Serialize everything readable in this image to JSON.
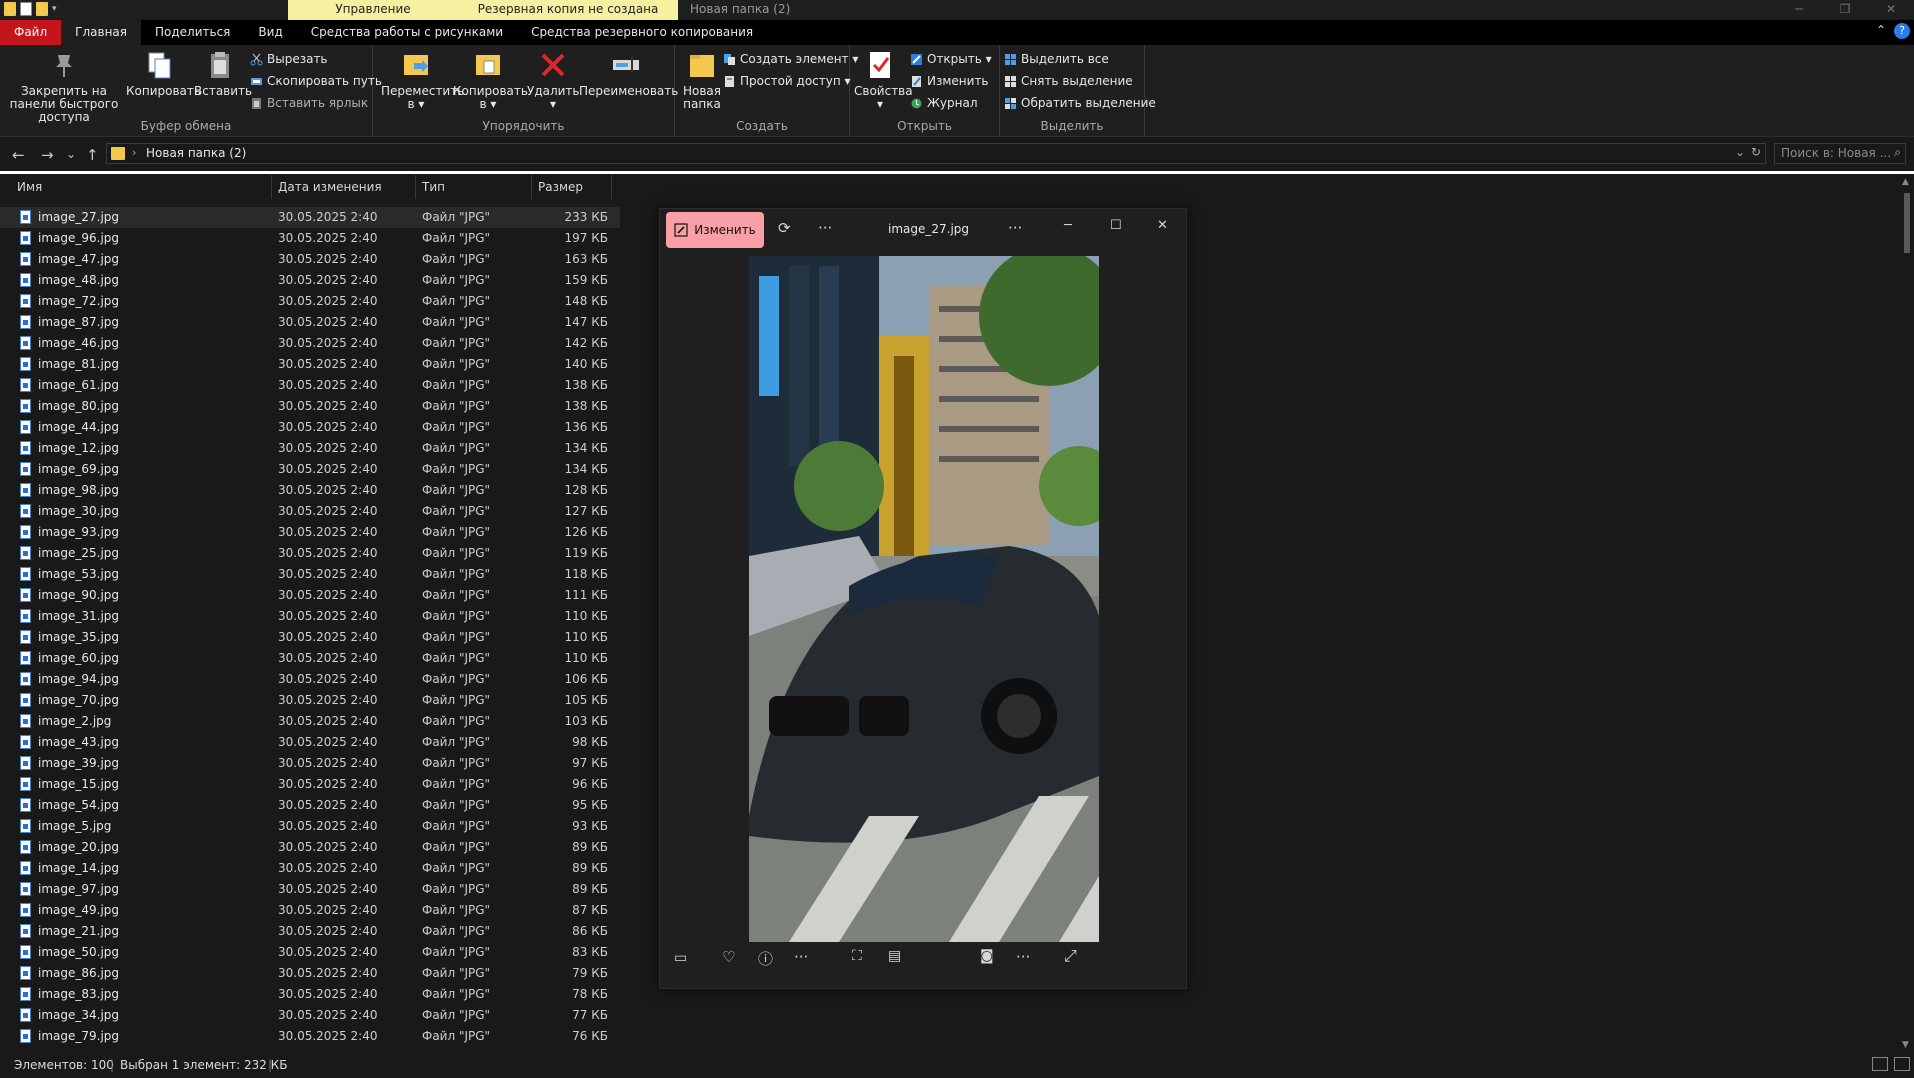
{
  "titlebar": {
    "context_tab_manage": "Управление",
    "context_tab_backup": "Резервная копия не создана",
    "window_title": "Новая папка (2)",
    "qa_arrow": "▾",
    "min": "─",
    "max": "❐",
    "close": "✕"
  },
  "tabs": {
    "file": "Файл",
    "home": "Главная",
    "share": "Поделиться",
    "view": "Вид",
    "picture_tools": "Средства работы с рисунками",
    "backup_tools": "Средства резервного копирования",
    "collapse": "⌃",
    "help": "?"
  },
  "ribbon": {
    "clipboard": {
      "pin": "Закрепить на панели быстрого доступа",
      "copy": "Копировать",
      "paste": "Вставить",
      "cut": "Вырезать",
      "copy_path": "Скопировать путь",
      "paste_shortcut": "Вставить ярлык",
      "label": "Буфер обмена"
    },
    "organize": {
      "move_to": "Переместить в ▾",
      "copy_to": "Копировать в ▾",
      "delete": "Удалить ▾",
      "rename": "Переименовать",
      "label": "Упорядочить"
    },
    "create": {
      "new_folder": "Новая папка",
      "new_item": "Создать элемент ▾",
      "easy_access": "Простой доступ ▾",
      "label": "Создать"
    },
    "open": {
      "properties": "Свойства ▾",
      "open": "Открыть ▾",
      "edit": "Изменить",
      "history": "Журнал",
      "label": "Открыть"
    },
    "select": {
      "select_all": "Выделить все",
      "select_none": "Снять выделение",
      "invert": "Обратить выделение",
      "label": "Выделить"
    }
  },
  "address": {
    "back": "←",
    "forward": "→",
    "recent": "⌄",
    "up": "↑",
    "sep": "›",
    "path": "Новая папка (2)",
    "dropdown": "⌄",
    "refresh": "↻",
    "search_placeholder": "Поиск в: Новая ...",
    "search_icon": "⌕"
  },
  "columns": {
    "name": "Имя",
    "date": "Дата изменения",
    "type": "Тип",
    "size": "Размер"
  },
  "files": [
    {
      "name": "image_27.jpg",
      "date": "30.05.2025 2:40",
      "type": "Файл \"JPG\"",
      "size": "233 КБ"
    },
    {
      "name": "image_96.jpg",
      "date": "30.05.2025 2:40",
      "type": "Файл \"JPG\"",
      "size": "197 КБ"
    },
    {
      "name": "image_47.jpg",
      "date": "30.05.2025 2:40",
      "type": "Файл \"JPG\"",
      "size": "163 КБ"
    },
    {
      "name": "image_48.jpg",
      "date": "30.05.2025 2:40",
      "type": "Файл \"JPG\"",
      "size": "159 КБ"
    },
    {
      "name": "image_72.jpg",
      "date": "30.05.2025 2:40",
      "type": "Файл \"JPG\"",
      "size": "148 КБ"
    },
    {
      "name": "image_87.jpg",
      "date": "30.05.2025 2:40",
      "type": "Файл \"JPG\"",
      "size": "147 КБ"
    },
    {
      "name": "image_46.jpg",
      "date": "30.05.2025 2:40",
      "type": "Файл \"JPG\"",
      "size": "142 КБ"
    },
    {
      "name": "image_81.jpg",
      "date": "30.05.2025 2:40",
      "type": "Файл \"JPG\"",
      "size": "140 КБ"
    },
    {
      "name": "image_61.jpg",
      "date": "30.05.2025 2:40",
      "type": "Файл \"JPG\"",
      "size": "138 КБ"
    },
    {
      "name": "image_80.jpg",
      "date": "30.05.2025 2:40",
      "type": "Файл \"JPG\"",
      "size": "138 КБ"
    },
    {
      "name": "image_44.jpg",
      "date": "30.05.2025 2:40",
      "type": "Файл \"JPG\"",
      "size": "136 КБ"
    },
    {
      "name": "image_12.jpg",
      "date": "30.05.2025 2:40",
      "type": "Файл \"JPG\"",
      "size": "134 КБ"
    },
    {
      "name": "image_69.jpg",
      "date": "30.05.2025 2:40",
      "type": "Файл \"JPG\"",
      "size": "134 КБ"
    },
    {
      "name": "image_98.jpg",
      "date": "30.05.2025 2:40",
      "type": "Файл \"JPG\"",
      "size": "128 КБ"
    },
    {
      "name": "image_30.jpg",
      "date": "30.05.2025 2:40",
      "type": "Файл \"JPG\"",
      "size": "127 КБ"
    },
    {
      "name": "image_93.jpg",
      "date": "30.05.2025 2:40",
      "type": "Файл \"JPG\"",
      "size": "126 КБ"
    },
    {
      "name": "image_25.jpg",
      "date": "30.05.2025 2:40",
      "type": "Файл \"JPG\"",
      "size": "119 КБ"
    },
    {
      "name": "image_53.jpg",
      "date": "30.05.2025 2:40",
      "type": "Файл \"JPG\"",
      "size": "118 КБ"
    },
    {
      "name": "image_90.jpg",
      "date": "30.05.2025 2:40",
      "type": "Файл \"JPG\"",
      "size": "111 КБ"
    },
    {
      "name": "image_31.jpg",
      "date": "30.05.2025 2:40",
      "type": "Файл \"JPG\"",
      "size": "110 КБ"
    },
    {
      "name": "image_35.jpg",
      "date": "30.05.2025 2:40",
      "type": "Файл \"JPG\"",
      "size": "110 КБ"
    },
    {
      "name": "image_60.jpg",
      "date": "30.05.2025 2:40",
      "type": "Файл \"JPG\"",
      "size": "110 КБ"
    },
    {
      "name": "image_94.jpg",
      "date": "30.05.2025 2:40",
      "type": "Файл \"JPG\"",
      "size": "106 КБ"
    },
    {
      "name": "image_70.jpg",
      "date": "30.05.2025 2:40",
      "type": "Файл \"JPG\"",
      "size": "105 КБ"
    },
    {
      "name": "image_2.jpg",
      "date": "30.05.2025 2:40",
      "type": "Файл \"JPG\"",
      "size": "103 КБ"
    },
    {
      "name": "image_43.jpg",
      "date": "30.05.2025 2:40",
      "type": "Файл \"JPG\"",
      "size": "98 КБ"
    },
    {
      "name": "image_39.jpg",
      "date": "30.05.2025 2:40",
      "type": "Файл \"JPG\"",
      "size": "97 КБ"
    },
    {
      "name": "image_15.jpg",
      "date": "30.05.2025 2:40",
      "type": "Файл \"JPG\"",
      "size": "96 КБ"
    },
    {
      "name": "image_54.jpg",
      "date": "30.05.2025 2:40",
      "type": "Файл \"JPG\"",
      "size": "95 КБ"
    },
    {
      "name": "image_5.jpg",
      "date": "30.05.2025 2:40",
      "type": "Файл \"JPG\"",
      "size": "93 КБ"
    },
    {
      "name": "image_20.jpg",
      "date": "30.05.2025 2:40",
      "type": "Файл \"JPG\"",
      "size": "89 КБ"
    },
    {
      "name": "image_14.jpg",
      "date": "30.05.2025 2:40",
      "type": "Файл \"JPG\"",
      "size": "89 КБ"
    },
    {
      "name": "image_97.jpg",
      "date": "30.05.2025 2:40",
      "type": "Файл \"JPG\"",
      "size": "89 КБ"
    },
    {
      "name": "image_49.jpg",
      "date": "30.05.2025 2:40",
      "type": "Файл \"JPG\"",
      "size": "87 КБ"
    },
    {
      "name": "image_21.jpg",
      "date": "30.05.2025 2:40",
      "type": "Файл \"JPG\"",
      "size": "86 КБ"
    },
    {
      "name": "image_50.jpg",
      "date": "30.05.2025 2:40",
      "type": "Файл \"JPG\"",
      "size": "83 КБ"
    },
    {
      "name": "image_86.jpg",
      "date": "30.05.2025 2:40",
      "type": "Файл \"JPG\"",
      "size": "79 КБ"
    },
    {
      "name": "image_83.jpg",
      "date": "30.05.2025 2:40",
      "type": "Файл \"JPG\"",
      "size": "78 КБ"
    },
    {
      "name": "image_34.jpg",
      "date": "30.05.2025 2:40",
      "type": "Файл \"JPG\"",
      "size": "77 КБ"
    },
    {
      "name": "image_79.jpg",
      "date": "30.05.2025 2:40",
      "type": "Файл \"JPG\"",
      "size": "76 КБ"
    }
  ],
  "status": {
    "count": "Элементов: 100",
    "selected": "Выбран 1 элемент: 232 КБ"
  },
  "viewer": {
    "edit": "Изменить",
    "title": "image_27.jpg",
    "more": "···",
    "rotate": "⟳",
    "min": "─",
    "max": "☐",
    "close": "✕",
    "favorite": "♡",
    "info": "ⓘ",
    "expand": "⤢"
  },
  "colors": {
    "file_tab": "#c4141c",
    "context_tab": "#f6f1a1",
    "edit_button": "#f8a0a6",
    "folder": "#f2c94c"
  }
}
